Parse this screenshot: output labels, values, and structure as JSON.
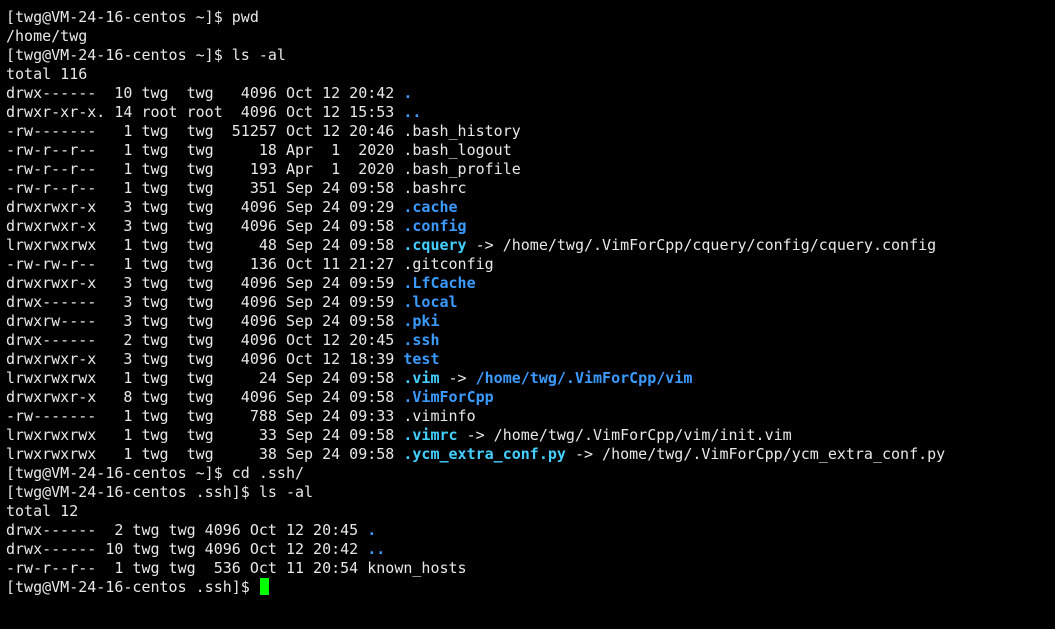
{
  "theme": {
    "background": "#000000",
    "foreground": "#e8e8e8",
    "directory_color": "#3b9bff",
    "symlink_color": "#44d0ff",
    "cursor_color": "#00ff00"
  },
  "lines": [
    {
      "segments": [
        {
          "text": "[twg@VM-24-16-centos ~]$ pwd",
          "style": "normal"
        }
      ]
    },
    {
      "segments": [
        {
          "text": "/home/twg",
          "style": "normal"
        }
      ]
    },
    {
      "segments": [
        {
          "text": "[twg@VM-24-16-centos ~]$ ls -al",
          "style": "normal"
        }
      ]
    },
    {
      "segments": [
        {
          "text": "total 116",
          "style": "normal"
        }
      ]
    },
    {
      "segments": [
        {
          "text": "drwx------  10 twg  twg   4096 Oct 12 20:42 ",
          "style": "normal"
        },
        {
          "text": ".",
          "style": "dir"
        }
      ]
    },
    {
      "segments": [
        {
          "text": "drwxr-xr-x. 14 root root  4096 Oct 12 15:53 ",
          "style": "normal"
        },
        {
          "text": "..",
          "style": "dir"
        }
      ]
    },
    {
      "segments": [
        {
          "text": "-rw-------   1 twg  twg  51257 Oct 12 20:46 .bash_history",
          "style": "normal"
        }
      ]
    },
    {
      "segments": [
        {
          "text": "-rw-r--r--   1 twg  twg     18 Apr  1  2020 .bash_logout",
          "style": "normal"
        }
      ]
    },
    {
      "segments": [
        {
          "text": "-rw-r--r--   1 twg  twg    193 Apr  1  2020 .bash_profile",
          "style": "normal"
        }
      ]
    },
    {
      "segments": [
        {
          "text": "-rw-r--r--   1 twg  twg    351 Sep 24 09:58 .bashrc",
          "style": "normal"
        }
      ]
    },
    {
      "segments": [
        {
          "text": "drwxrwxr-x   3 twg  twg   4096 Sep 24 09:29 ",
          "style": "normal"
        },
        {
          "text": ".cache",
          "style": "dir"
        }
      ]
    },
    {
      "segments": [
        {
          "text": "drwxrwxr-x   3 twg  twg   4096 Sep 24 09:58 ",
          "style": "normal"
        },
        {
          "text": ".config",
          "style": "dir"
        }
      ]
    },
    {
      "segments": [
        {
          "text": "lrwxrwxrwx   1 twg  twg     48 Sep 24 09:58 ",
          "style": "normal"
        },
        {
          "text": ".cquery",
          "style": "link"
        },
        {
          "text": " -> /home/twg/.VimForCpp/cquery/config/cquery.config",
          "style": "normal"
        }
      ]
    },
    {
      "segments": [
        {
          "text": "-rw-rw-r--   1 twg  twg    136 Oct 11 21:27 .gitconfig",
          "style": "normal"
        }
      ]
    },
    {
      "segments": [
        {
          "text": "drwxrwxr-x   3 twg  twg   4096 Sep 24 09:59 ",
          "style": "normal"
        },
        {
          "text": ".LfCache",
          "style": "dir"
        }
      ]
    },
    {
      "segments": [
        {
          "text": "drwx------   3 twg  twg   4096 Sep 24 09:59 ",
          "style": "normal"
        },
        {
          "text": ".local",
          "style": "dir"
        }
      ]
    },
    {
      "segments": [
        {
          "text": "drwxrw----   3 twg  twg   4096 Sep 24 09:58 ",
          "style": "normal"
        },
        {
          "text": ".pki",
          "style": "dir"
        }
      ]
    },
    {
      "segments": [
        {
          "text": "drwx------   2 twg  twg   4096 Oct 12 20:45 ",
          "style": "normal"
        },
        {
          "text": ".ssh",
          "style": "dir"
        }
      ]
    },
    {
      "segments": [
        {
          "text": "drwxrwxr-x   3 twg  twg   4096 Oct 12 18:39 ",
          "style": "normal"
        },
        {
          "text": "test",
          "style": "dir"
        }
      ]
    },
    {
      "segments": [
        {
          "text": "lrwxrwxrwx   1 twg  twg     24 Sep 24 09:58 ",
          "style": "normal"
        },
        {
          "text": ".vim",
          "style": "link"
        },
        {
          "text": " -> ",
          "style": "normal"
        },
        {
          "text": "/home/twg/.VimForCpp/vim",
          "style": "linkdir"
        }
      ]
    },
    {
      "segments": [
        {
          "text": "drwxrwxr-x   8 twg  twg   4096 Sep 24 09:58 ",
          "style": "normal"
        },
        {
          "text": ".VimForCpp",
          "style": "dir"
        }
      ]
    },
    {
      "segments": [
        {
          "text": "-rw-------   1 twg  twg    788 Sep 24 09:33 .viminfo",
          "style": "normal"
        }
      ]
    },
    {
      "segments": [
        {
          "text": "lrwxrwxrwx   1 twg  twg     33 Sep 24 09:58 ",
          "style": "normal"
        },
        {
          "text": ".vimrc",
          "style": "link"
        },
        {
          "text": " -> /home/twg/.VimForCpp/vim/init.vim",
          "style": "normal"
        }
      ]
    },
    {
      "segments": [
        {
          "text": "lrwxrwxrwx   1 twg  twg     38 Sep 24 09:58 ",
          "style": "normal"
        },
        {
          "text": ".ycm_extra_conf.py",
          "style": "link"
        },
        {
          "text": " -> /home/twg/.VimForCpp/ycm_extra_conf.py",
          "style": "normal"
        }
      ]
    },
    {
      "segments": [
        {
          "text": "[twg@VM-24-16-centos ~]$ cd .ssh/",
          "style": "normal"
        }
      ]
    },
    {
      "segments": [
        {
          "text": "[twg@VM-24-16-centos .ssh]$ ls -al",
          "style": "normal"
        }
      ]
    },
    {
      "segments": [
        {
          "text": "total 12",
          "style": "normal"
        }
      ]
    },
    {
      "segments": [
        {
          "text": "drwx------  2 twg twg 4096 Oct 12 20:45 ",
          "style": "normal"
        },
        {
          "text": ".",
          "style": "dir"
        }
      ]
    },
    {
      "segments": [
        {
          "text": "drwx------ 10 twg twg 4096 Oct 12 20:42 ",
          "style": "normal"
        },
        {
          "text": "..",
          "style": "dir"
        }
      ]
    },
    {
      "segments": [
        {
          "text": "-rw-r--r--  1 twg twg  536 Oct 11 20:54 known_hosts",
          "style": "normal"
        }
      ]
    }
  ],
  "prompt": {
    "text": "[twg@VM-24-16-centos .ssh]$ ",
    "cursor": "block-cursor"
  }
}
